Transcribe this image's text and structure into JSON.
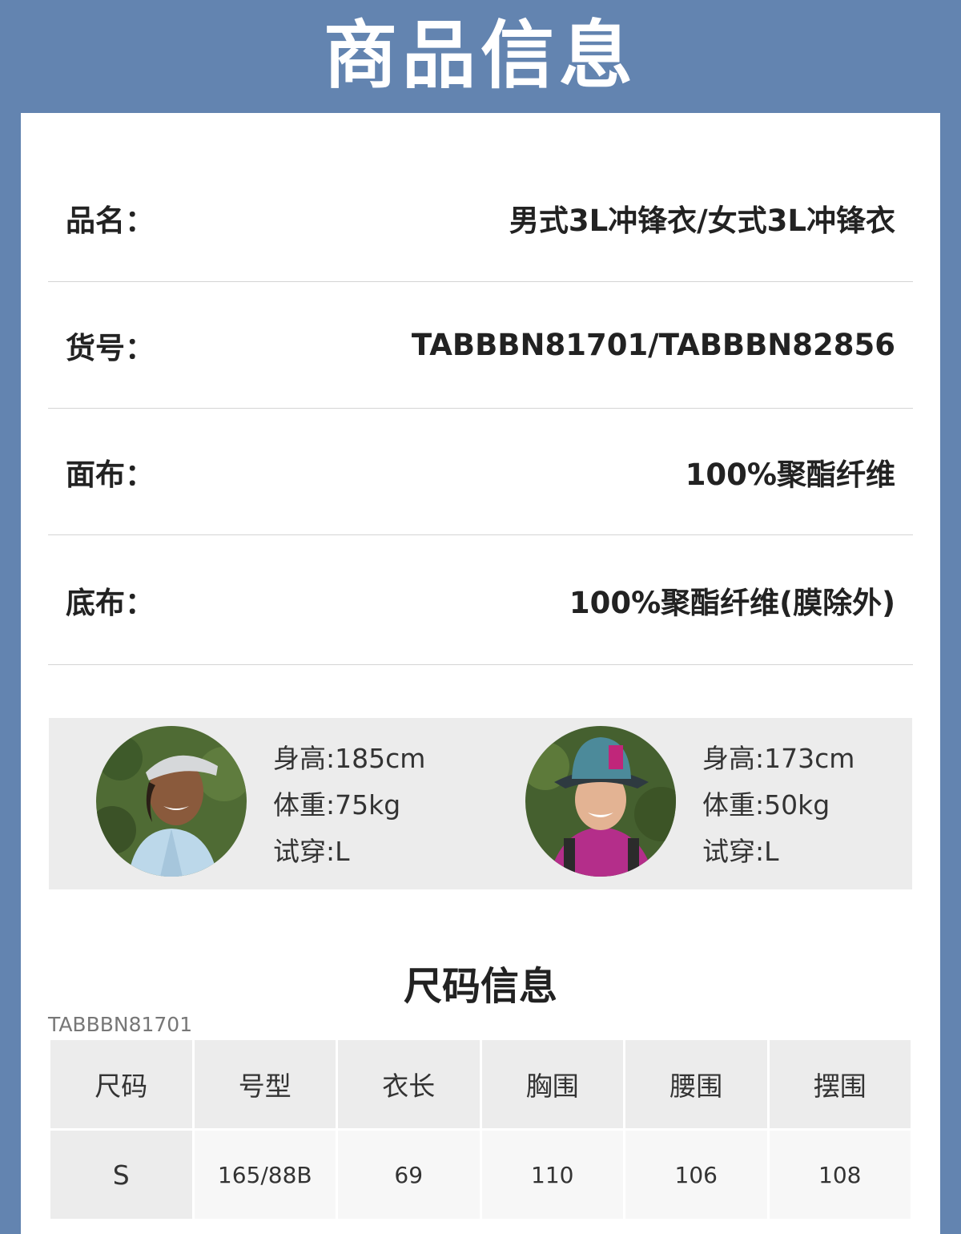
{
  "header": {
    "title": "商品信息"
  },
  "product_info": [
    {
      "label": "品名：",
      "value": "男式3L冲锋衣/女式3L冲锋衣"
    },
    {
      "label": "货号：",
      "value": "TABBBN81701/TABBBN82856"
    },
    {
      "label": "面布：",
      "value": "100%聚酯纤维"
    },
    {
      "label": "底布：",
      "value": "100%聚酯纤维(膜除外)"
    }
  ],
  "models": [
    {
      "height": "身高:185cm",
      "weight": "体重:75kg",
      "fit": "试穿:L"
    },
    {
      "height": "身高:173cm",
      "weight": "体重:50kg",
      "fit": "试穿:L"
    }
  ],
  "size_section": {
    "title": "尺码信息",
    "sku": "TABBBN81701",
    "headers": [
      "尺码",
      "号型",
      "衣长",
      "胸围",
      "腰围",
      "摆围"
    ],
    "rows": [
      [
        "S",
        "165/88B",
        "69",
        "110",
        "106",
        "108"
      ]
    ]
  },
  "colors": {
    "background": "#6384b0",
    "card": "#ffffff",
    "panel": "#ececec"
  }
}
